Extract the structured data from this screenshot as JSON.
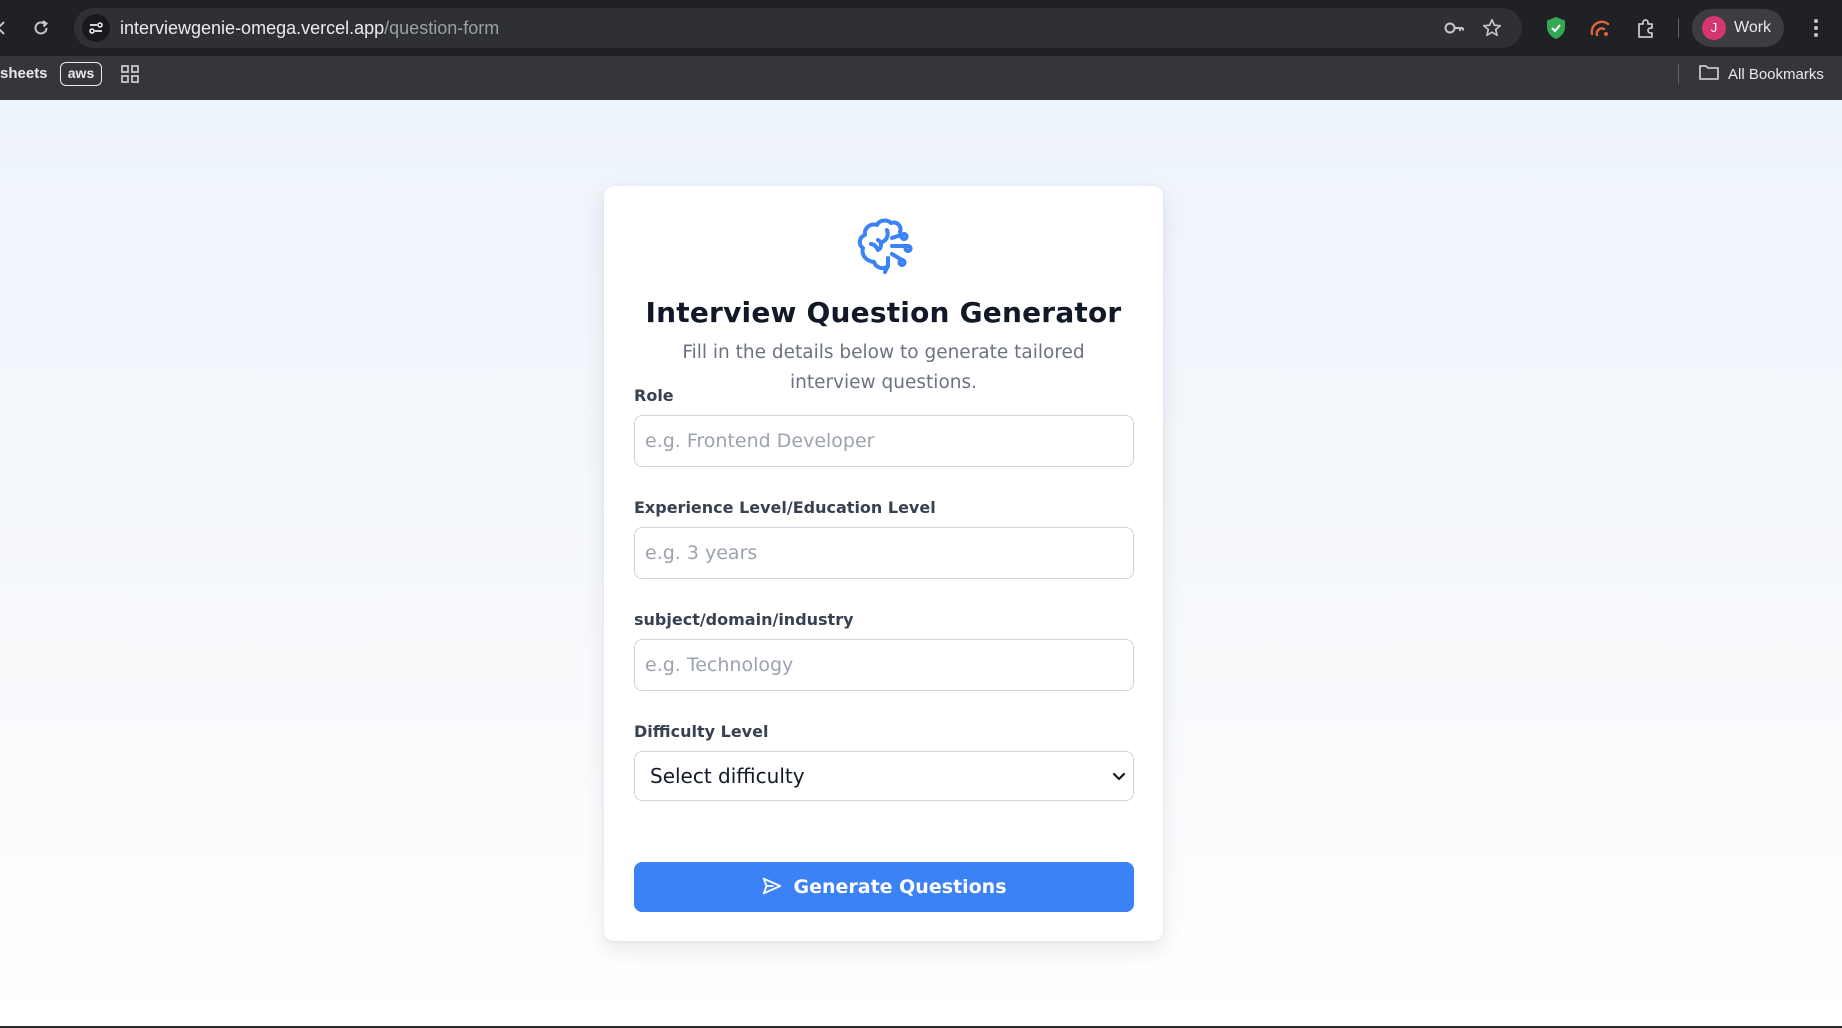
{
  "browser": {
    "url_host": "interviewgenie-omega.vercel.app",
    "url_path": "/question-form",
    "profile_initial": "J",
    "profile_label": "Work",
    "bookmarks": {
      "sheets": "sheets",
      "aws": "aws",
      "all_bookmarks": "All Bookmarks"
    }
  },
  "form": {
    "title": "Interview Question Generator",
    "subtitle": "Fill in the details below to generate tailored interview questions.",
    "role": {
      "label": "Role",
      "placeholder": "e.g. Frontend Developer",
      "value": ""
    },
    "experience": {
      "label": "Experience Level/Education Level",
      "placeholder": "e.g. 3 years",
      "value": ""
    },
    "domain": {
      "label": "subject/domain/industry",
      "placeholder": "e.g. Technology",
      "value": ""
    },
    "difficulty": {
      "label": "Difficulty Level",
      "selected": "Select difficulty"
    },
    "submit_label": "Generate Questions"
  },
  "colors": {
    "accent": "#3b82f6",
    "avatar": "#d43673",
    "shield": "#34a853"
  }
}
